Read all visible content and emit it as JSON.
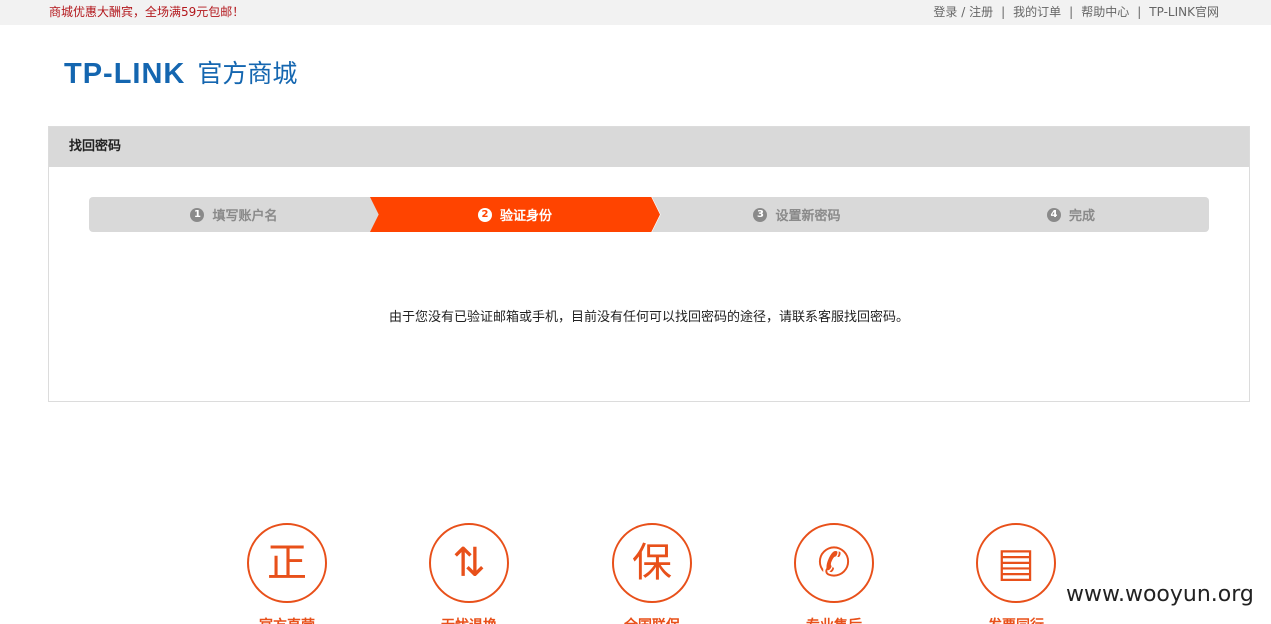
{
  "topbar": {
    "promo": "商城优惠大酬宾，全场满59元包邮！",
    "links": [
      "登录 / 注册",
      "我的订单",
      "帮助中心",
      "TP-LINK官网"
    ]
  },
  "logo": {
    "mark": "TP-LINK",
    "sub": "官方商城"
  },
  "panel": {
    "title": "找回密码",
    "steps": [
      {
        "num": "1",
        "label": "填写账户名"
      },
      {
        "num": "2",
        "label": "验证身份"
      },
      {
        "num": "3",
        "label": "设置新密码"
      },
      {
        "num": "4",
        "label": "完成"
      }
    ],
    "message": "由于您没有已验证邮箱或手机，目前没有任何可以找回密码的途径，请联系客服找回密码。"
  },
  "features": [
    {
      "icon": "正",
      "label": "官方直营"
    },
    {
      "icon": "⇅",
      "label": "无忧退换"
    },
    {
      "icon": "保",
      "label": "全国联保"
    },
    {
      "icon": "✆",
      "label": "专业售后"
    },
    {
      "icon": "▤",
      "label": "发票同行"
    }
  ],
  "watermark": "www.wooyun.org",
  "colors": {
    "accent": "#ff4400",
    "brand": "#1466b0",
    "promo": "#b3171c"
  }
}
